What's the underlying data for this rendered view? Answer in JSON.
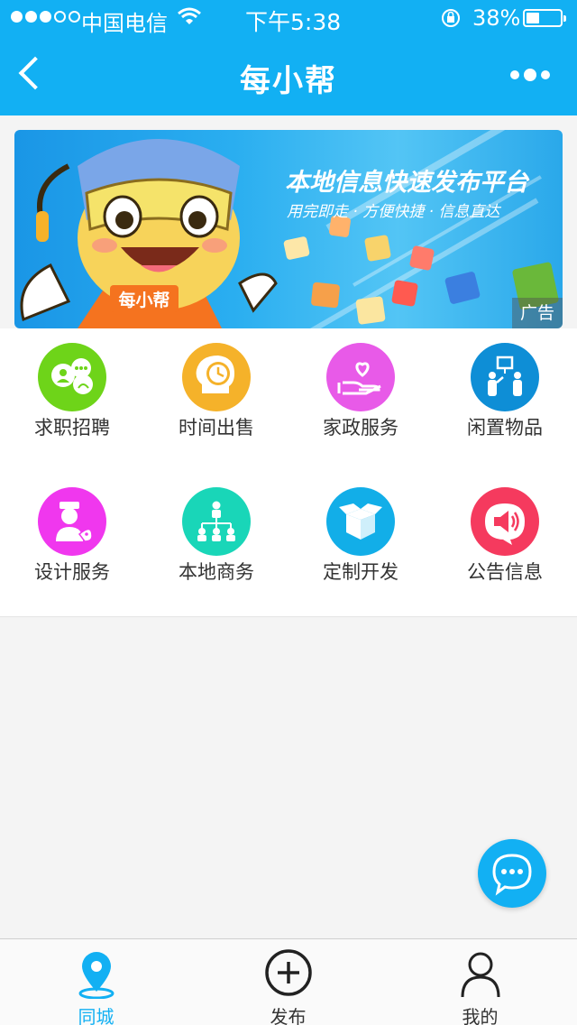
{
  "status_bar": {
    "carrier": "中国电信",
    "time": "下午5:38",
    "battery_text": "38%",
    "battery_level": 0.38,
    "signal_strength": 3,
    "signal_max": 5
  },
  "nav": {
    "title": "每小帮",
    "back_icon": "chevron-left-icon",
    "more_icon": "more-dots-icon"
  },
  "banner": {
    "headline": "本地信息快速发布平台",
    "subline": "用完即走 · 方便快捷 · 信息直达",
    "mascot_text": "每小帮",
    "ad_label": "广告"
  },
  "categories": [
    {
      "label": "求职招聘",
      "color": "#6ed419",
      "icon": "chat-users-icon"
    },
    {
      "label": "时间出售",
      "color": "#f5b22a",
      "icon": "head-clock-icon"
    },
    {
      "label": "家政服务",
      "color": "#e85ae8",
      "icon": "hand-heart-icon"
    },
    {
      "label": "闲置物品",
      "color": "#0e8ed6",
      "icon": "people-board-icon"
    },
    {
      "label": "设计服务",
      "color": "#f037ee",
      "icon": "designer-icon"
    },
    {
      "label": "本地商务",
      "color": "#19d6b8",
      "icon": "org-chart-icon"
    },
    {
      "label": "定制开发",
      "color": "#12aee8",
      "icon": "box-icon"
    },
    {
      "label": "公告信息",
      "color": "#f53a5e",
      "icon": "megaphone-icon"
    }
  ],
  "fab": {
    "icon": "chat-bubble-icon",
    "color": "#12b0f3"
  },
  "tabs": [
    {
      "label": "同城",
      "icon": "location-pin-icon",
      "active": true
    },
    {
      "label": "发布",
      "icon": "plus-circle-icon",
      "active": false
    },
    {
      "label": "我的",
      "icon": "user-icon",
      "active": false
    }
  ],
  "colors": {
    "brand": "#12b0f3",
    "background": "#f4f4f4"
  }
}
